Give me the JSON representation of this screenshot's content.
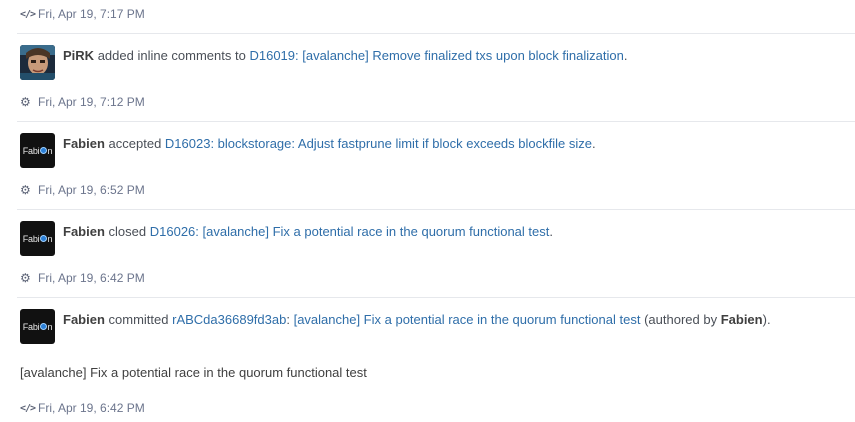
{
  "events": [
    {
      "type": "timestamp",
      "icon": "code-icon",
      "time": "Fri, Apr 19, 7:17 PM"
    },
    {
      "type": "story",
      "avatar": "PiRK",
      "user": "PiRK",
      "verb": "added inline comments to",
      "link": "D16019: [avalanche] Remove finalized txs upon block finalization",
      "suffix": ".",
      "time": "Fri, Apr 19, 7:12 PM",
      "time_icon": "gear-icon"
    },
    {
      "type": "story",
      "avatar": "Fabien",
      "user": "Fabien",
      "verb": "accepted",
      "link": "D16023: blockstorage: Adjust fastprune limit if block exceeds blockfile size",
      "suffix": ".",
      "time": "Fri, Apr 19, 6:52 PM",
      "time_icon": "gear-icon"
    },
    {
      "type": "story",
      "avatar": "Fabien",
      "user": "Fabien",
      "verb": "closed",
      "link": "D16026: [avalanche] Fix a potential race in the quorum functional test",
      "suffix": ".",
      "time": "Fri, Apr 19, 6:42 PM",
      "time_icon": "gear-icon"
    },
    {
      "type": "story",
      "avatar": "Fabien",
      "user": "Fabien",
      "verb": "committed",
      "commit": "rABCda36689fd3ab",
      "sep": ":",
      "link": "[avalanche] Fix a potential race in the quorum functional test",
      "authored_prefix": "(authored by",
      "authored_user": "Fabien",
      "authored_suffix": ").",
      "body": "[avalanche] Fix a potential race in the quorum functional test",
      "time": "Fri, Apr 19, 6:42 PM",
      "time_icon": "code-icon"
    }
  ],
  "avatar_text": {
    "fabien_pre": "Fabi",
    "fabien_post": "n"
  },
  "colors": {
    "link": "#2f6ea9",
    "text": "#4a4f57",
    "muted": "#6b748c"
  }
}
